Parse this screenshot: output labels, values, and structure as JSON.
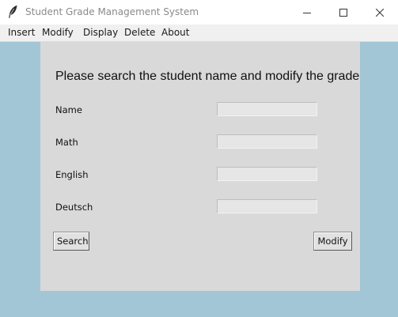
{
  "window": {
    "title": "Student Grade Management System",
    "app_icon": "feather-icon",
    "controls": [
      "minimize-icon",
      "maximize-icon",
      "close-icon"
    ]
  },
  "menu": {
    "items": [
      {
        "label": "Insert"
      },
      {
        "label": "Modify"
      },
      {
        "label": "Display"
      },
      {
        "label": "Delete"
      },
      {
        "label": "About"
      }
    ]
  },
  "form": {
    "heading": "Please search the student name and modify the grade",
    "fields": [
      {
        "label": "Name",
        "value": ""
      },
      {
        "label": "Math",
        "value": ""
      },
      {
        "label": "English",
        "value": ""
      },
      {
        "label": "Deutsch",
        "value": ""
      }
    ],
    "search_label": "Search",
    "modify_label": "Modify"
  },
  "colors": {
    "background": "#a2c6d6",
    "panel": "#d9d9d9",
    "titlebar": "#ffffff",
    "menubar": "#f0f0f0"
  }
}
